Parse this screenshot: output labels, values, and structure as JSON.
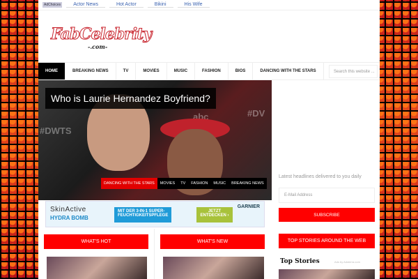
{
  "adbar": {
    "adchoices": "AdChoices",
    "links": [
      "Actor News",
      "Hot Actor",
      "Bikini",
      "His Wife"
    ]
  },
  "logo": {
    "main": "FabCelebrity",
    "sub": "-.com-"
  },
  "nav": {
    "items": [
      "HOME",
      "BREAKING NEWS",
      "TV",
      "MOVIES",
      "MUSIC",
      "FASHION",
      "BIOS",
      "DANCING WITH THE STARS"
    ],
    "search_placeholder": "Search this website ..."
  },
  "hero": {
    "title": "Who is Laurie Hernandez Boyfriend?",
    "categories": [
      "DANCING WITH THE STARS",
      "MOVIES",
      "TV",
      "FASHION",
      "MUSIC",
      "BREAKING NEWS"
    ],
    "bg_tags": [
      "#DWTS",
      "abc",
      "#DV"
    ]
  },
  "ad": {
    "brand1": "SkinActive",
    "brand2": "HYDRA BOMB",
    "line1": "MIT DER 3-IN-1 SUPER-",
    "line2": "FEUCHTIGKEITSPFLEGE",
    "cta1": "JETZT",
    "cta2": "ENTDECKEN ›",
    "advertiser": "GARNIER"
  },
  "sidebar": {
    "tagline": "Latest headlines delivered to you daily",
    "email_placeholder": "E-Mail Address",
    "subscribe": "SUBSCRIBE",
    "top_stories_header": "TOP STORIES AROUND THE WEB",
    "top_stories": "Top Stories",
    "ads_by": "Ads by Adsterra.com"
  },
  "sections": {
    "hot": "WHAT'S HOT",
    "new": "WHAT'S NEW"
  },
  "colors": {
    "accent": "#ff0000",
    "nav_active": "#000000"
  }
}
